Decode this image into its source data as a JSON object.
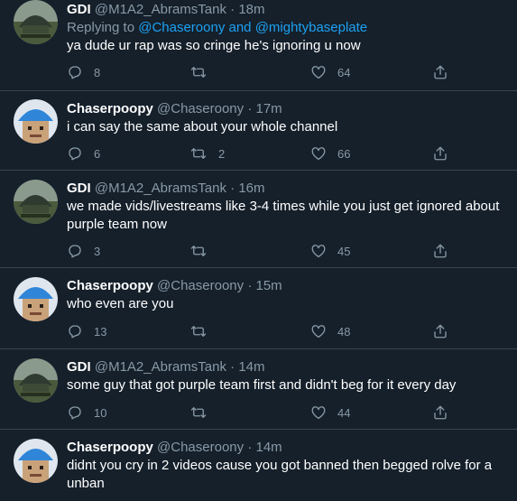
{
  "tweets": [
    {
      "name": "GDI",
      "handle": "@M1A2_AbramsTank",
      "dot": "·",
      "time": "18m",
      "replying_prefix": "Replying to ",
      "replying_to": "@Chaseroony and @mightybaseplate",
      "text": "ya dude ur rap was so cringe he's ignoring u now",
      "replies": "8",
      "retweets": "",
      "likes": "64"
    },
    {
      "name": "Chaserpoopy",
      "handle": "@Chaseroony",
      "dot": "·",
      "time": "17m",
      "text": "i can say the same about your whole channel",
      "replies": "6",
      "retweets": "2",
      "likes": "66"
    },
    {
      "name": "GDI",
      "handle": "@M1A2_AbramsTank",
      "dot": "·",
      "time": "16m",
      "text": "we made vids/livestreams like 3-4 times while you just get ignored about purple team now",
      "replies": "3",
      "retweets": "",
      "likes": "45"
    },
    {
      "name": "Chaserpoopy",
      "handle": "@Chaseroony",
      "dot": "·",
      "time": "15m",
      "text": "who even are you",
      "replies": "13",
      "retweets": "",
      "likes": "48"
    },
    {
      "name": "GDI",
      "handle": "@M1A2_AbramsTank",
      "dot": "·",
      "time": "14m",
      "text": "some guy that got purple team first and didn't beg for it every day",
      "replies": "10",
      "retweets": "",
      "likes": "44"
    },
    {
      "name": "Chaserpoopy",
      "handle": "@Chaseroony",
      "dot": "·",
      "time": "14m",
      "text": "didnt you cry in 2 videos cause you got banned then begged rolve for a unban"
    }
  ],
  "colors": {
    "background": "#15202b",
    "divider": "#38444d",
    "muted": "#8899a6",
    "link": "#1da1f2"
  },
  "icons": [
    "reply-icon",
    "retweet-icon",
    "like-icon",
    "share-icon"
  ]
}
